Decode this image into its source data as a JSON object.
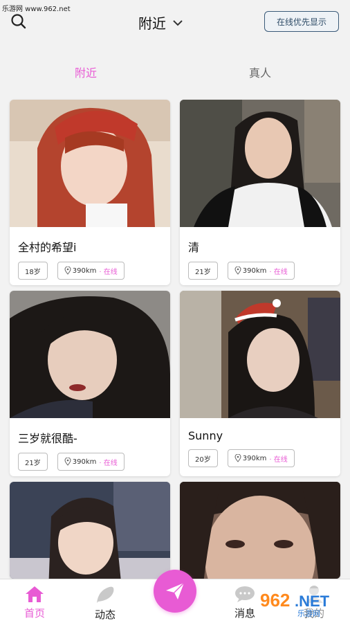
{
  "watermark": "乐游网 www.962.net",
  "header": {
    "title": "附近",
    "online_first_label": "在线优先显示"
  },
  "tabs": [
    {
      "label": "附近",
      "active": true
    },
    {
      "label": "真人",
      "active": false
    }
  ],
  "cards": [
    {
      "name": "全村的希望i",
      "age": "18岁",
      "distance": "390km",
      "status": "在线"
    },
    {
      "name": "清",
      "age": "21岁",
      "distance": "390km",
      "status": "在线"
    },
    {
      "name": "三岁就很酷-",
      "age": "21岁",
      "distance": "390km",
      "status": "在线"
    },
    {
      "name": "Sunny",
      "age": "20岁",
      "distance": "390km",
      "status": "在线"
    },
    {
      "name": "",
      "age": "",
      "distance": "",
      "status": ""
    },
    {
      "name": "",
      "age": "",
      "distance": "",
      "status": ""
    }
  ],
  "nav": {
    "home": "首页",
    "dynamic": "动态",
    "messages": "消息",
    "me": "我的"
  },
  "logo": "962.NET 乐游网",
  "colors": {
    "accent": "#e85bd4",
    "button_border": "#3a5a78"
  }
}
